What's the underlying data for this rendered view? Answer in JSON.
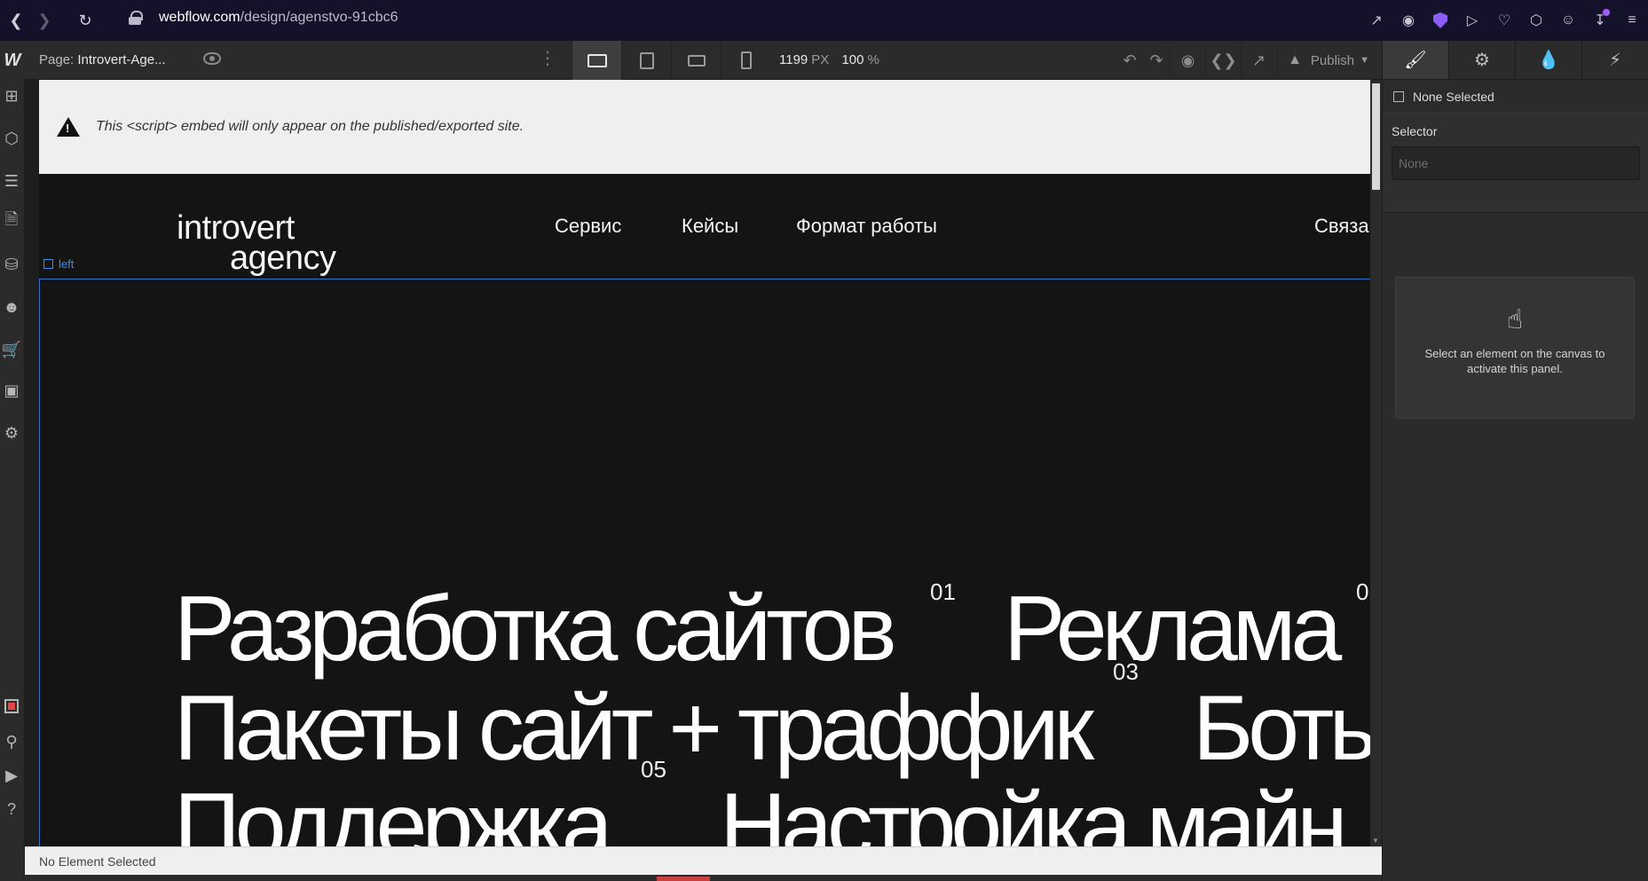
{
  "browser": {
    "url_domain": "webflow.com",
    "url_path": "/design/agenstvo-91cbc6",
    "back_icon": "chevron-left-icon",
    "forward_icon": "chevron-right-icon",
    "reload_icon": "reload-icon"
  },
  "toolbar": {
    "page_prefix": "Page:",
    "page_name": "Introvert-Age...",
    "width_value": "1199",
    "width_unit": "PX",
    "zoom_value": "100",
    "zoom_unit": "%",
    "publish_label": "Publish"
  },
  "panel": {
    "none_selected": "None Selected",
    "selector_label": "Selector",
    "selector_placeholder": "None",
    "empty_message": "Select an element on the canvas to activate this panel."
  },
  "canvas": {
    "embed_notice": "This <script> embed will only appear on the published/exported site.",
    "selected_tag": "left",
    "logo_line1": "introvert",
    "logo_line2": "agency",
    "nav": [
      "Сервис",
      "Кейсы",
      "Формат работы",
      "Связа"
    ],
    "services": [
      {
        "label": "Разработка сайтов",
        "num": "01"
      },
      {
        "label": "Реклама",
        "num": "0"
      },
      {
        "label": "Пакеты сайт + траффик",
        "num": "03"
      },
      {
        "label": "Боть",
        "num": ""
      },
      {
        "label": "Поддержка",
        "num": "05"
      },
      {
        "label": "Настройка майн",
        "num": ""
      }
    ]
  },
  "status_bar": {
    "text": "No Element Selected"
  }
}
